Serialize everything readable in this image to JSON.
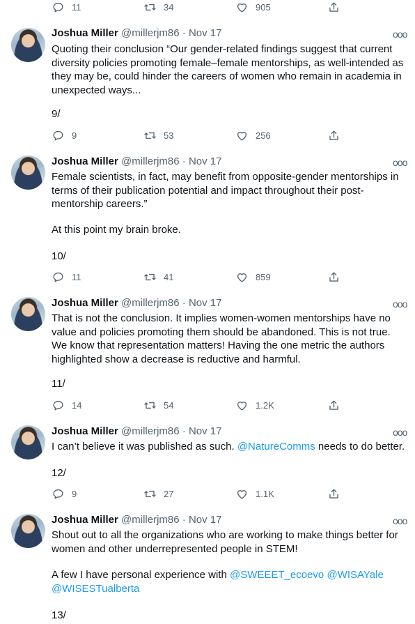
{
  "top_actions": {
    "reply": "11",
    "retweet": "34",
    "like": "905"
  },
  "tweets": [
    {
      "name": "Joshua Miller",
      "handle": "@millerjm86",
      "sep": "·",
      "date": "Nov 17",
      "more": "ooo",
      "text": "Quoting their conclusion “Our gender-related findings suggest that current diversity policies promoting female–female mentorships, as well-intended as they may be, could hinder the careers of women who remain in academia in unexpected ways...",
      "counter": "9/",
      "reply": "9",
      "retweet": "53",
      "like": "256"
    },
    {
      "name": "Joshua Miller",
      "handle": "@millerjm86",
      "sep": "·",
      "date": "Nov 17",
      "more": "ooo",
      "text": "Female scientists, in fact, may benefit from opposite-gender mentorships in terms of their publication potential and impact throughout their post-mentorship careers.”",
      "text2": "At this point my brain broke.",
      "counter": "10/",
      "reply": "11",
      "retweet": "41",
      "like": "859"
    },
    {
      "name": "Joshua Miller",
      "handle": "@millerjm86",
      "sep": "·",
      "date": "Nov 17",
      "more": "ooo",
      "text": "That is not the conclusion. It implies women-women mentorships have no value and policies promoting them should be abandoned. This is not true. We know that representation matters! Having the one metric the authors highlighted show a decrease is reductive and harmful.",
      "counter": "11/",
      "reply": "14",
      "retweet": "54",
      "like": "1.2K"
    },
    {
      "name": "Joshua Miller",
      "handle": "@millerjm86",
      "sep": "·",
      "date": "Nov 17",
      "more": "ooo",
      "text_before": "I can’t believe it was published as such. ",
      "mention": "@NatureComms",
      "text_after": " needs to do better.",
      "counter": "12/",
      "reply": "9",
      "retweet": "27",
      "like": "1.1K"
    },
    {
      "name": "Joshua Miller",
      "handle": "@millerjm86",
      "sep": "·",
      "date": "Nov 17",
      "more": "ooo",
      "text": "Shout out to all the organizations who are working to make things better for women and other underrepresented people in STEM!",
      "text2_before": "A few I have personal experience with ",
      "mention1": "@SWEEET_ecoevo",
      "mention2": "@WISAYale",
      "mention3": "@WISESTualberta",
      "counter": "13/"
    }
  ],
  "colors": {
    "text": "#0f1419",
    "secondary": "#536471",
    "link": "#1d9bf0"
  }
}
